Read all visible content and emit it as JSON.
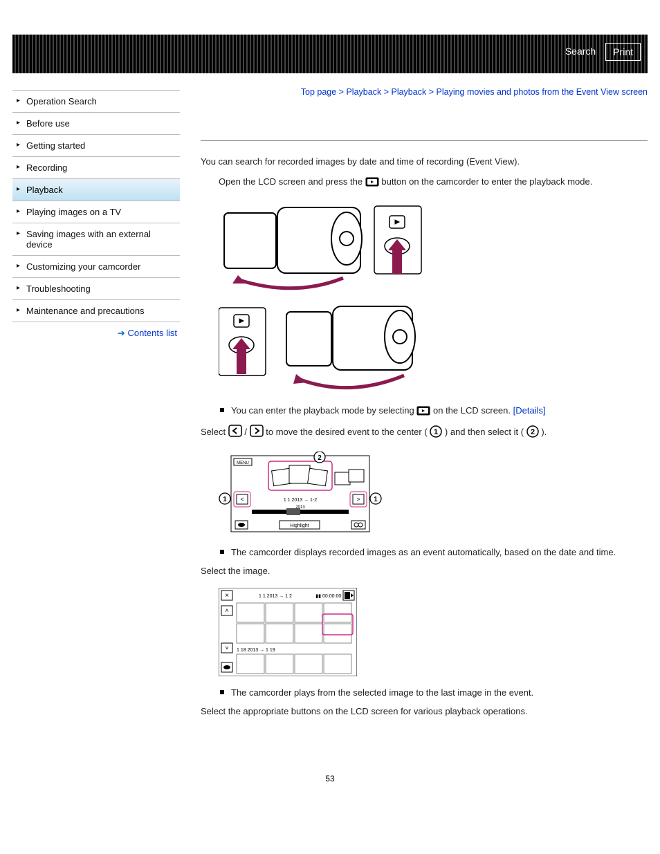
{
  "topbar": {
    "search": "Search",
    "print": "Print"
  },
  "sidebar": {
    "items": [
      {
        "label": "Operation Search",
        "active": false
      },
      {
        "label": "Before use",
        "active": false
      },
      {
        "label": "Getting started",
        "active": false
      },
      {
        "label": "Recording",
        "active": false
      },
      {
        "label": "Playback",
        "active": true
      },
      {
        "label": "Playing images on a TV",
        "active": false
      },
      {
        "label": "Saving images with an external device",
        "active": false
      },
      {
        "label": "Customizing your camcorder",
        "active": false
      },
      {
        "label": "Troubleshooting",
        "active": false
      },
      {
        "label": "Maintenance and precautions",
        "active": false
      }
    ],
    "contents_list": "Contents list"
  },
  "breadcrumb": {
    "top": "Top page",
    "l1": "Playback",
    "l2": "Playback",
    "l3": "Playing movies and photos from the Event View screen",
    "sep": ">"
  },
  "body": {
    "intro": "You can search for recorded images by date and time of recording (Event View).",
    "step1_a": "Open the LCD screen and press the ",
    "step1_b": " button on the camcorder to enter the playback mode.",
    "bullet1_a": "You can enter the playback mode by selecting ",
    "bullet1_b": " on the LCD screen. ",
    "details": "[Details]",
    "step2_a": "Select ",
    "step2_mid": " / ",
    "step2_b": " to move the desired event to the center (",
    "step2_c": ") and then select it (",
    "step2_d": ").",
    "bullet2": "The camcorder displays recorded images as an event automatically, based on the date and time.",
    "step3": "Select the image.",
    "bullet3": "The camcorder plays from the selected image to the last image in the event.",
    "step4": "Select the appropriate buttons on the LCD screen for various playback operations."
  },
  "fig3": {
    "menu": "MENU",
    "date": "1 1 2013 → 1-2",
    "timeline": "2013",
    "highlight": "Highlight"
  },
  "fig4": {
    "date1": "1 1 2013 → 1 2",
    "time": "00:00:00",
    "date2": "1 18 2013 → 1 19"
  },
  "page_number": "53"
}
